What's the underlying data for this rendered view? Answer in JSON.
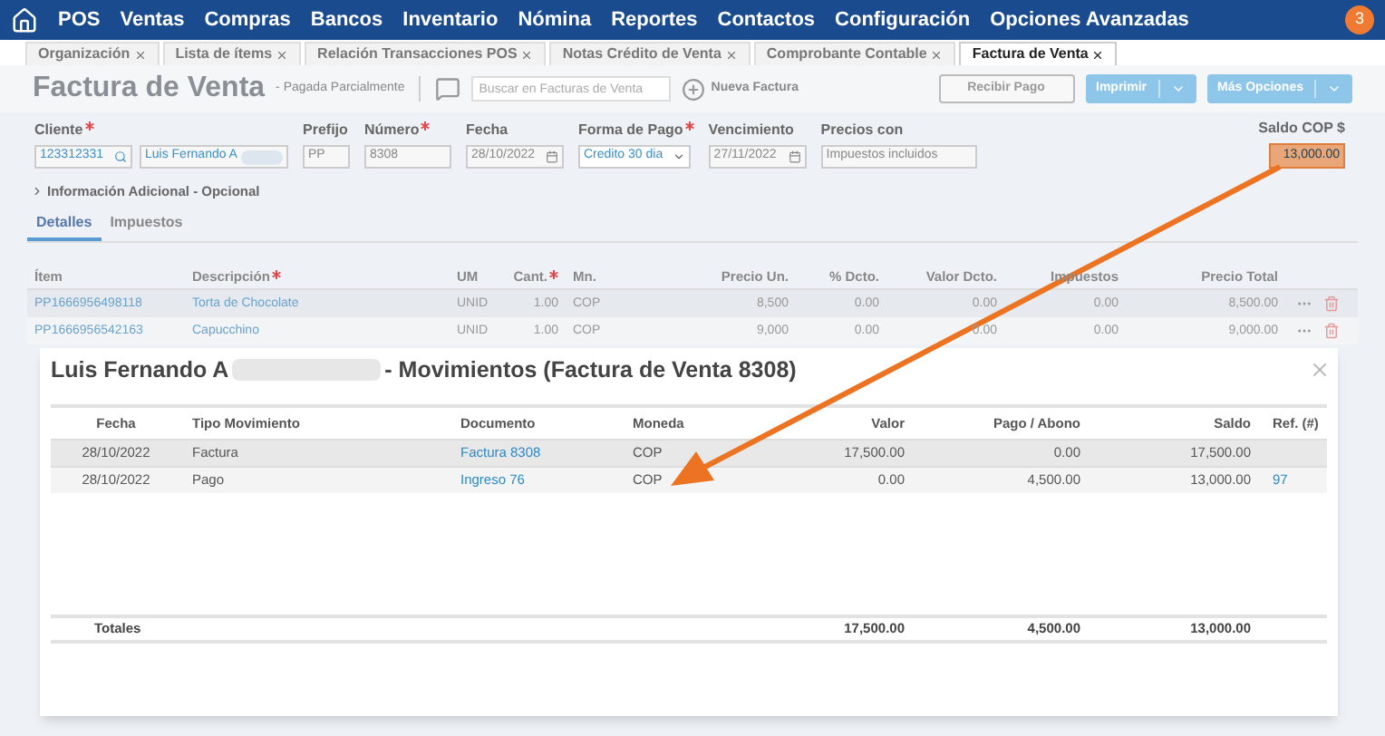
{
  "nav": {
    "items": [
      "POS",
      "Ventas",
      "Compras",
      "Bancos",
      "Inventario",
      "Nómina",
      "Reportes",
      "Contactos",
      "Configuración",
      "Opciones Avanzadas"
    ],
    "badge": "3"
  },
  "tabs": [
    {
      "label": "Organización",
      "selected": false
    },
    {
      "label": "Lista de ítems",
      "selected": false
    },
    {
      "label": "Relación Transacciones POS",
      "selected": false
    },
    {
      "label": "Notas Crédito de Venta",
      "selected": false
    },
    {
      "label": "Comprobante Contable",
      "selected": false
    },
    {
      "label": "Factura de Venta",
      "selected": true
    }
  ],
  "header": {
    "title": "Factura de Venta",
    "status": "- Pagada Parcialmente",
    "search_placeholder": "Buscar en Facturas de Venta",
    "new_label": "Nueva Factura",
    "buttons": [
      {
        "label": "Recibir Pago",
        "kind": "outline"
      },
      {
        "label": "Imprimir",
        "kind": "split"
      },
      {
        "label": "Más Opciones",
        "kind": "split"
      }
    ]
  },
  "form": {
    "fields": [
      {
        "label": "Cliente",
        "required": true,
        "kind": "client",
        "value": "123312331",
        "value_2": "Luis Fernando A"
      },
      {
        "label": "Prefijo",
        "required": false,
        "kind": "text",
        "value": "PP"
      },
      {
        "label": "Número",
        "required": true,
        "kind": "text",
        "value": "8308"
      },
      {
        "label": "Fecha",
        "required": false,
        "kind": "date",
        "value": "28/10/2022"
      },
      {
        "label": "Forma de Pago",
        "required": true,
        "kind": "select",
        "value": "Credito 30 dia"
      },
      {
        "label": "Vencimiento",
        "required": false,
        "kind": "date",
        "value": "27/11/2022"
      },
      {
        "label": "Precios con",
        "required": false,
        "kind": "text",
        "value": "Impuestos incluidos"
      }
    ],
    "balance_label": "Saldo COP $",
    "balance_value": "13,000.00",
    "additional": "Información Adicional - Opcional",
    "expanded": false
  },
  "detail_tabs": [
    {
      "label": "Detalles",
      "selected": true
    },
    {
      "label": "Impuestos",
      "selected": false
    }
  ],
  "items_table": {
    "columns": [
      {
        "label": "Ítem",
        "required": false
      },
      {
        "label": "Descripción",
        "required": true
      },
      {
        "label": "UM",
        "required": false
      },
      {
        "label": "Cant.",
        "required": true
      },
      {
        "label": "Mn.",
        "required": false
      },
      {
        "label": "Precio Un.",
        "required": false
      },
      {
        "label": "% Dcto.",
        "required": false
      },
      {
        "label": "Valor Dcto.",
        "required": false
      },
      {
        "label": "Impuestos",
        "required": false
      },
      {
        "label": "Precio Total",
        "required": false
      }
    ],
    "rows": [
      [
        "PP1666956498118",
        "Torta de Chocolate",
        "UNID",
        "1.00",
        "COP",
        "8,500",
        "0.00",
        "0.00",
        "0.00",
        "8,500.00"
      ],
      [
        "PP1666956542163",
        "Capucchino",
        "UNID",
        "1.00",
        "COP",
        "9,000",
        "0.00",
        "0.00",
        "0.00",
        "9,000.00"
      ]
    ]
  },
  "modal": {
    "title_start": "Luis Fernando A",
    "title_end": "- Movimientos (Factura de Venta 8308)",
    "columns": [
      "Fecha",
      "Tipo Movimiento",
      "Documento",
      "Moneda",
      "Valor",
      "Pago / Abono",
      "Saldo",
      "Ref. (#)"
    ],
    "rows": [
      {
        "selected": true,
        "cells": [
          "28/10/2022",
          "Factura",
          "Factura 8308",
          "COP",
          "17,500.00",
          "0.00",
          "17,500.00"
        ]
      },
      {
        "selected": false,
        "cells": [
          "28/10/2022",
          "Pago",
          "Ingreso 76",
          "COP",
          "0.00",
          "4,500.00",
          "13,000.00",
          "97"
        ]
      }
    ],
    "totals": [
      "Totales",
      "17,500.00",
      "4,500.00",
      "13,000.00"
    ]
  }
}
